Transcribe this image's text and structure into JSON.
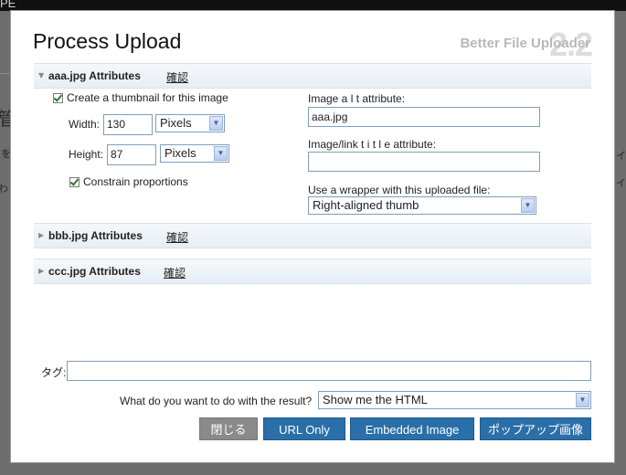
{
  "background": {
    "logo": "PE",
    "left_char": "管",
    "left_bracket": "[を",
    "left_fragment": "わ",
    "right_fragment1": "イ",
    "right_fragment2": "イ"
  },
  "dialog": {
    "title": "Process Upload",
    "brand": "Better File Uploader",
    "version": "2.2"
  },
  "sections": [
    {
      "name": "aaa.jpg Attributes",
      "confirm": "確認",
      "expanded": true
    },
    {
      "name": "bbb.jpg Attributes",
      "confirm": "確認",
      "expanded": false
    },
    {
      "name": "ccc.jpg Attributes",
      "confirm": "確認",
      "expanded": false
    }
  ],
  "image_form": {
    "thumbnail_label": "Create a thumbnail for this image",
    "thumbnail_checked": true,
    "width_label": "Width:",
    "width_value": "130",
    "width_unit": "Pixels",
    "height_label": "Height:",
    "height_value": "87",
    "height_unit": "Pixels",
    "constrain_label": "Constrain proportions",
    "constrain_checked": true,
    "alt_label": "Image a l t attribute:",
    "alt_value": "aaa.jpg",
    "title_label": "Image/link t i t l e attribute:",
    "title_value": "",
    "wrapper_label": "Use a wrapper with this uploaded file:",
    "wrapper_value": "Right-aligned thumb"
  },
  "tags": {
    "label": "タグ:",
    "value": ""
  },
  "result": {
    "label": "What do you want to do with the result?",
    "value": "Show me the HTML"
  },
  "buttons": {
    "close": "閉じる",
    "url_only": "URL Only",
    "embedded": "Embedded Image",
    "popup": "ポップアップ画像"
  }
}
